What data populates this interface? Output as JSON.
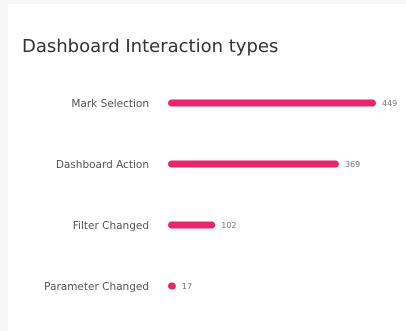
{
  "chart_data": {
    "type": "bar",
    "orientation": "horizontal",
    "title": "Dashboard Interaction types",
    "categories": [
      "Mark Selection",
      "Dashboard Action",
      "Filter Changed",
      "Parameter Changed"
    ],
    "values": [
      449,
      369,
      102,
      17
    ],
    "value_labels": [
      "449",
      "369",
      "102",
      "17"
    ],
    "xlim": [
      0,
      449
    ],
    "grid": false,
    "legend": "none",
    "bar_color": "#e8266b"
  }
}
